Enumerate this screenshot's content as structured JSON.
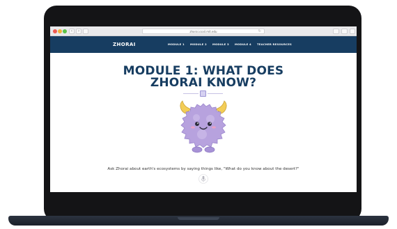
{
  "browser": {
    "url": "zhorai.csail.mit.edu"
  },
  "site": {
    "logo": "ZHORAI",
    "nav": [
      {
        "label": "MODULE 1"
      },
      {
        "label": "MODULE 2"
      },
      {
        "label": "MODULE 3"
      },
      {
        "label": "MODULE 4"
      },
      {
        "label": "TEACHER RESOURCES"
      }
    ],
    "brand_color": "#173d61"
  },
  "main": {
    "title_line1": "MODULE 1: WHAT DOES",
    "title_line2": "ZHORAI KNOW?",
    "prompt": "Ask Zhorai about earth's ecosystems by saying things like, \"What do you know about the desert?\"",
    "mascot_icon": "zhorai-mascot",
    "mic_icon": "microphone-icon"
  }
}
